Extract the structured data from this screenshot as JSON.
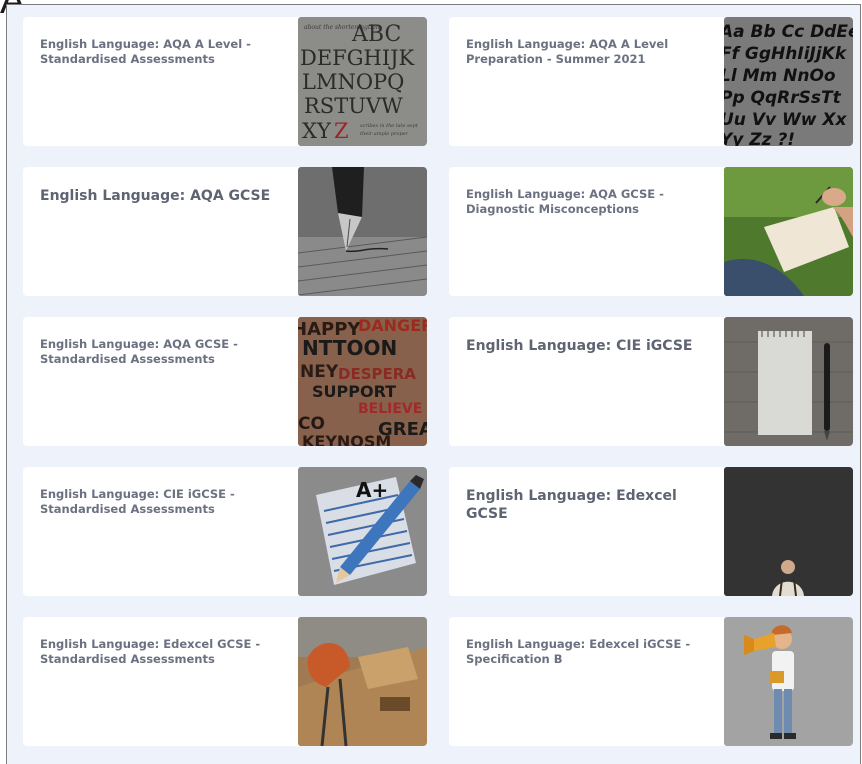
{
  "overlay_label": "A",
  "courses": [
    {
      "title": "English Language: AQA A Level - Standardised Assessments",
      "image": "calligraphy-alphabet-image"
    },
    {
      "title": "English Language: AQA A Level Preparation - Summer 2021",
      "image": "handwritten-alphabet-image"
    },
    {
      "title": "English Language: AQA GCSE",
      "image": "fountain-pen-image"
    },
    {
      "title": "English Language: AQA GCSE - Diagnostic Misconceptions",
      "image": "writing-on-grass-image"
    },
    {
      "title": "English Language: AQA GCSE - Standardised Assessments",
      "image": "graffiti-words-image"
    },
    {
      "title": "English Language: CIE iGCSE",
      "image": "notepad-pen-image"
    },
    {
      "title": "English Language: CIE iGCSE - Standardised Assessments",
      "image": "a-plus-paper-image"
    },
    {
      "title": "English Language: Edexcel GCSE",
      "image": "chalkboard-person-image"
    },
    {
      "title": "English Language: Edexcel GCSE - Standardised Assessments",
      "image": "desk-chair-image"
    },
    {
      "title": "English Language: Edexcel iGCSE - Specification B",
      "image": "megaphone-man-image"
    }
  ]
}
